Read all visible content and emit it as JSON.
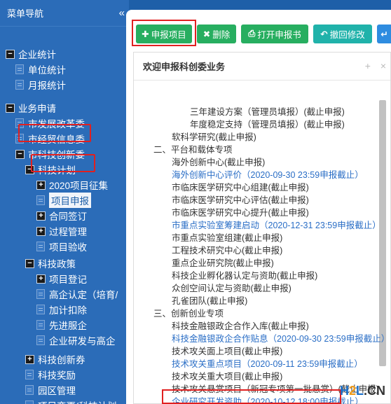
{
  "sidebar": {
    "title": "菜单导航",
    "collapse_icon": "«",
    "items": [
      {
        "label": "企业统计",
        "kind": "toggle",
        "sign": "−"
      },
      {
        "label": "单位统计",
        "kind": "doc"
      },
      {
        "label": "月报统计",
        "kind": "doc"
      },
      {
        "label": "业务申请",
        "kind": "toggle",
        "sign": "−"
      },
      {
        "label": "市发展改革委",
        "kind": "doc"
      },
      {
        "label": "市经贸信息委",
        "kind": "doc"
      },
      {
        "label": "市科技创新委",
        "kind": "toggle",
        "sign": "−"
      },
      {
        "label": "科技计划",
        "kind": "toggle",
        "sign": "−"
      },
      {
        "label": "2020项目征集",
        "kind": "toggle",
        "sign": "+"
      },
      {
        "label": "项目申报",
        "kind": "doc"
      },
      {
        "label": "合同签订",
        "kind": "toggle",
        "sign": "+"
      },
      {
        "label": "过程管理",
        "kind": "toggle",
        "sign": "+"
      },
      {
        "label": "项目验收",
        "kind": "doc"
      },
      {
        "label": "科技政策",
        "kind": "toggle",
        "sign": "−"
      },
      {
        "label": "项目登记",
        "kind": "toggle",
        "sign": "+"
      },
      {
        "label": "高企认定（培育/",
        "kind": "doc"
      },
      {
        "label": "加计扣除",
        "kind": "doc"
      },
      {
        "label": "先进服企",
        "kind": "doc"
      },
      {
        "label": "企业研发与高企",
        "kind": "doc"
      },
      {
        "label": "科技创新券",
        "kind": "toggle",
        "sign": "+"
      },
      {
        "label": "科技奖励",
        "kind": "doc"
      },
      {
        "label": "园区管理",
        "kind": "doc"
      },
      {
        "label": "项目变更(科技计划",
        "kind": "doc"
      }
    ]
  },
  "toolbar": {
    "add": "申报项目",
    "delete": "删除",
    "open": "打开申报书",
    "revoke": "撤回修改"
  },
  "panel": {
    "title": "欢迎申报科创委业务",
    "plus_icon": "+",
    "close_icon": "×",
    "lines": [
      {
        "text": "三年建设方案（管理员填报）(截止申报)",
        "link": false
      },
      {
        "text": "年度稳定支持（管理员填报）(截止申报)",
        "link": false
      },
      {
        "text": "软科学研究(截止申报)",
        "link": false
      },
      {
        "text": "二、平台和载体专项",
        "link": false
      },
      {
        "text": "海外创新中心(截止申报)",
        "link": false
      },
      {
        "text": "海外创新中心评价（2020-09-30 23:59申报截止）",
        "link": true
      },
      {
        "text": "市临床医学研究中心组建(截止申报)",
        "link": false
      },
      {
        "text": "市临床医学研究中心评估(截止申报)",
        "link": false
      },
      {
        "text": "市临床医学研究中心提升(截止申报)",
        "link": false
      },
      {
        "text": "市重点实验室筹建启动（2020-12-31 23:59申报截止）",
        "link": true
      },
      {
        "text": "市重点实验室组建(截止申报)",
        "link": false
      },
      {
        "text": "工程技术研究中心(截止申报)",
        "link": false
      },
      {
        "text": "重点企业研究院(截止申报)",
        "link": false
      },
      {
        "text": "科技企业孵化器认定与资助(截止申报)",
        "link": false
      },
      {
        "text": "众创空间认定与资助(截止申报)",
        "link": false
      },
      {
        "text": "孔雀团队(截止申报)",
        "link": false
      },
      {
        "text": "三、创新创业专项",
        "link": false
      },
      {
        "text": "科技金融银政企合作入库(截止申报)",
        "link": false
      },
      {
        "text": "科技金融银政企合作贴息（2020-09-30 23:59申报截止）",
        "link": true
      },
      {
        "text": "技术攻关面上项目(截止申报)",
        "link": false
      },
      {
        "text": "技术攻关重点项目（2020-09-11 23:59申报截止）",
        "link": true
      },
      {
        "text": "技术攻关重大项目(截止申报)",
        "link": false
      },
      {
        "text": "技术攻关悬赏项目（新冠专项第一批悬赏）(截止申报)",
        "link": false
      },
      {
        "text": "企业研究开发资助（2020-10-12 18:00申报截止）",
        "link": true
      }
    ]
  },
  "watermark": {
    "h": "H",
    "two": "2",
    "l": "L",
    "cn": ".CN"
  }
}
